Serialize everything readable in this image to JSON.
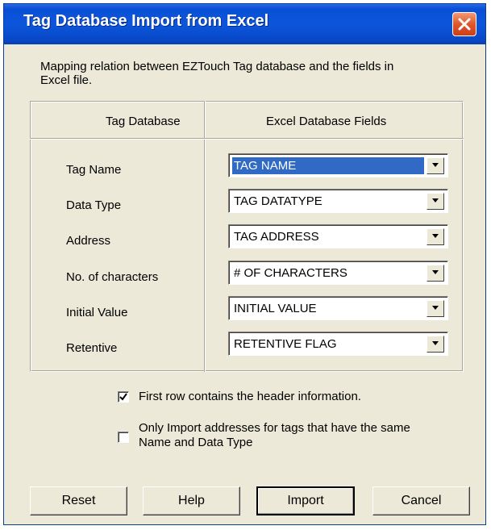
{
  "window": {
    "title": "Tag Database Import from Excel",
    "close_icon": "close-x-icon"
  },
  "description": {
    "line1": "Mapping relation between EZTouch Tag database and the fields in",
    "line2": "Excel file."
  },
  "mapping": {
    "header_tag": "Tag Database",
    "header_excel": "Excel Database Fields",
    "rows": [
      {
        "label": "Tag Name",
        "value": "TAG NAME",
        "selected": true
      },
      {
        "label": "Data Type",
        "value": "TAG DATATYPE",
        "selected": false
      },
      {
        "label": "Address",
        "value": "TAG ADDRESS",
        "selected": false
      },
      {
        "label": "No. of characters",
        "value": "# OF CHARACTERS",
        "selected": false
      },
      {
        "label": "Initial Value",
        "value": "INITIAL VALUE",
        "selected": false
      },
      {
        "label": "Retentive",
        "value": "RETENTIVE FLAG",
        "selected": false
      }
    ]
  },
  "options": {
    "first_row_header": {
      "label": "First row contains the header information.",
      "checked": true
    },
    "only_import_same": {
      "line1": "Only Import addresses for tags that have the same",
      "line2": "Name and Data Type",
      "checked": false
    }
  },
  "buttons": {
    "reset": "Reset",
    "help": "Help",
    "import": "Import",
    "cancel": "Cancel"
  },
  "colors": {
    "title_bar": "#0a4fd6",
    "dialog_bg": "#ece9d8",
    "selection": "#316ac5",
    "close_button": "#e0572c"
  }
}
